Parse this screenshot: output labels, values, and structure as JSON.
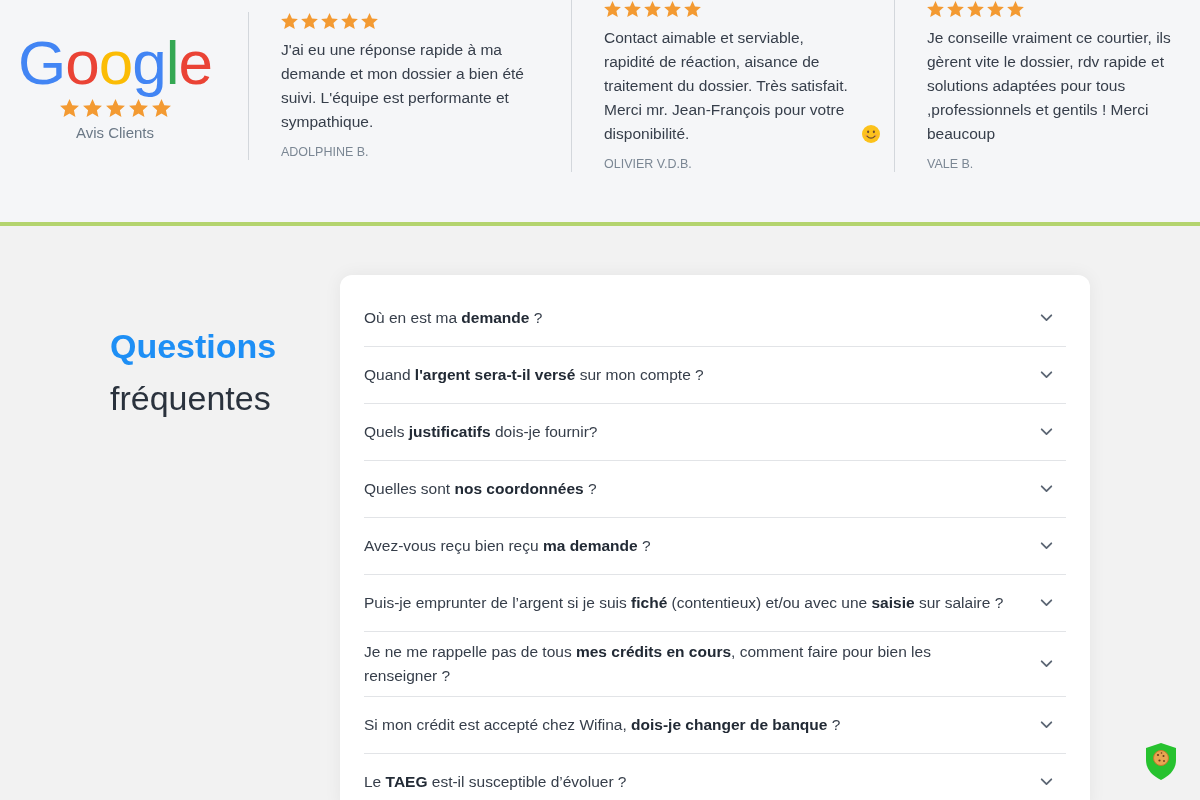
{
  "reviews_band": {
    "badge": {
      "logo": "Google",
      "stars": 5,
      "label": "Avis Clients"
    },
    "reviews": [
      {
        "stars": 5,
        "text": "J'ai eu une réponse rapide à ma demande et mon dossier a bien été suivi. L'équipe est performante et sympathique.",
        "smiley_emoji": false,
        "author": "ADOLPHINE B."
      },
      {
        "stars": 5,
        "text": "Contact aimable et serviable, rapidité de réaction, aisance de traitement du dossier. Très satisfait. Merci mr. Jean-François pour votre disponibilité.",
        "smiley_emoji": true,
        "author": "OLIVIER V.D.B."
      },
      {
        "stars": 5,
        "text": "Je conseille vraiment ce courtier, ils gèrent vite le dossier, rdv rapide et solutions adaptées pour tous ,professionnels et gentils ! Merci beaucoup",
        "smiley_emoji": false,
        "author": "VALE B."
      }
    ]
  },
  "faq": {
    "title_accent": "Questions",
    "title": "fréquentes",
    "items": [
      {
        "question": "Où en est ma **demande** ?",
        "expanded": false
      },
      {
        "question": "Quand **l'argent sera-t-il versé** sur mon compte ?",
        "expanded": false
      },
      {
        "question": "Quels **justificatifs** dois-je fournir?",
        "expanded": false
      },
      {
        "question": "Quelles sont **nos coordonnées** ?",
        "expanded": false
      },
      {
        "question": "Avez-vous reçu bien reçu **ma demande** ?",
        "expanded": false
      },
      {
        "question": "Puis-je emprunter de l’argent si je suis **fiché** (contentieux) et/ou avec une **saisie** sur salaire ?",
        "expanded": false
      },
      {
        "question": "Je ne me rappelle pas de tous **mes crédits en cours**, comment faire pour bien les renseigner ?",
        "expanded": false
      },
      {
        "question": "Si mon crédit est accepté chez Wifina, **dois-je changer de banque** ?",
        "expanded": false
      },
      {
        "question": "Le **TAEG** est-il susceptible d’évoluer ?",
        "expanded": false
      }
    ]
  }
}
